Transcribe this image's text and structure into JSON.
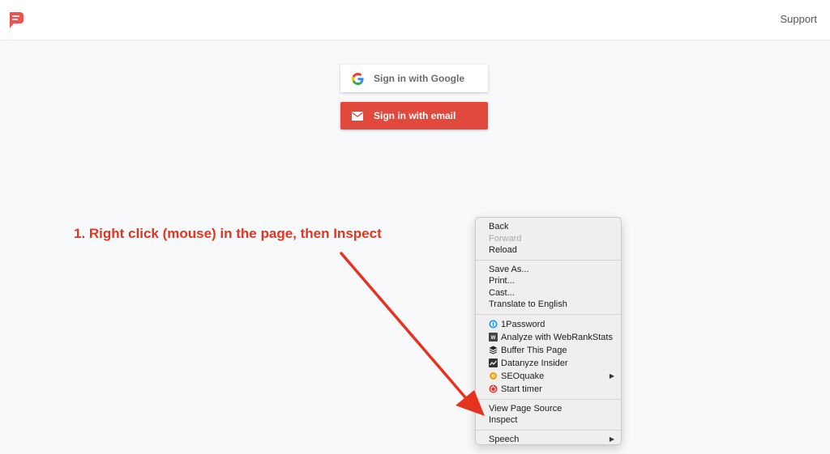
{
  "header": {
    "logo_icon": "speech-bubble-logo-icon",
    "support_label": "Support",
    "brand_color": "#ef5350"
  },
  "auth": {
    "google_label": "Sign in with Google",
    "google_icon": "google-g-icon",
    "email_label": "Sign in with email",
    "email_icon": "envelope-icon",
    "email_color": "#e0493c"
  },
  "annotation": {
    "text": "1. Right click (mouse) in the page, then Inspect",
    "color": "#e63320"
  },
  "context_menu": {
    "group1": [
      {
        "label": "Back",
        "enabled": true
      },
      {
        "label": "Forward",
        "enabled": false
      },
      {
        "label": "Reload",
        "enabled": true
      }
    ],
    "group2": [
      {
        "label": "Save As..."
      },
      {
        "label": "Print..."
      },
      {
        "label": "Cast..."
      },
      {
        "label": "Translate to English"
      }
    ],
    "group3": [
      {
        "label": "1Password",
        "icon": "1password-icon"
      },
      {
        "label": "Analyze with WebRankStats",
        "icon": "webrankstats-icon"
      },
      {
        "label": "Buffer This Page",
        "icon": "buffer-icon"
      },
      {
        "label": "Datanyze Insider",
        "icon": "datanyze-icon"
      },
      {
        "label": "SEOquake",
        "icon": "seoquake-icon",
        "submenu": "▶"
      },
      {
        "label": "Start timer",
        "icon": "timer-icon"
      }
    ],
    "group4": [
      {
        "label": "View Page Source"
      },
      {
        "label": "Inspect"
      }
    ],
    "group5": [
      {
        "label": "Speech",
        "submenu": "▶"
      }
    ]
  }
}
